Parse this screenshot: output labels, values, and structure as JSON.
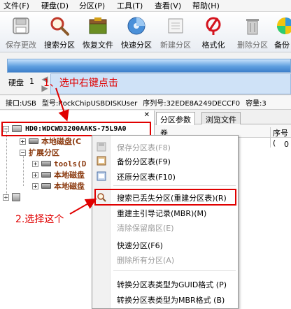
{
  "menu": [
    "文件(F)",
    "硬盘(D)",
    "分区(P)",
    "工具(T)",
    "查看(V)",
    "帮助(H)"
  ],
  "toolbar": [
    {
      "label": "保存更改",
      "icon": "save-icon",
      "enabled": false
    },
    {
      "label": "搜索分区",
      "icon": "search-partition-icon",
      "enabled": true
    },
    {
      "label": "恢复文件",
      "icon": "recover-file-icon",
      "enabled": true
    },
    {
      "label": "快速分区",
      "icon": "quick-partition-icon",
      "enabled": true
    },
    {
      "label": "新建分区",
      "icon": "new-partition-icon",
      "enabled": false
    },
    {
      "label": "格式化",
      "icon": "format-icon",
      "enabled": true
    },
    {
      "label": "删除分区",
      "icon": "delete-partition-icon",
      "enabled": false
    },
    {
      "label": "备份",
      "icon": "backup-icon",
      "enabled": true
    }
  ],
  "disk": {
    "label": "硬盘",
    "number": "1"
  },
  "info": {
    "interface": "接口:USB",
    "model": "型号:RockChipUSBDISKUser",
    "serial": "序列号:32EDE8A249DECCF0",
    "capacity": "容量:3"
  },
  "tree": {
    "disk_node": "HD0:WDCWD3200AAKS-75L9A0",
    "items": [
      {
        "label": "本地磁盘(C",
        "level": 1,
        "expander": "+"
      },
      {
        "label": "扩展分区",
        "level": 1,
        "expander": "−"
      },
      {
        "label": "tools(D",
        "level": 2,
        "expander": "+"
      },
      {
        "label": "本地磁盘",
        "level": 2,
        "expander": "+"
      },
      {
        "label": "本地磁盘",
        "level": 2,
        "expander": "+"
      }
    ]
  },
  "tabs": [
    "分区参数",
    "浏览文件"
  ],
  "table": {
    "col1": "卷",
    "col2": "序号(",
    "row0_value": "0"
  },
  "context_menu": [
    {
      "label": "保存分区表(F8)",
      "enabled": false,
      "icon": "save-table-icon"
    },
    {
      "label": "备份分区表(F9)",
      "enabled": true,
      "icon": "backup-table-icon"
    },
    {
      "label": "还原分区表(F10)",
      "enabled": true,
      "icon": "restore-table-icon"
    },
    {
      "label": "搜索已丢失分区(重建分区表)(R)",
      "enabled": true,
      "icon": "search-lost-partition-icon"
    },
    {
      "label": "重建主引导记录(MBR)(M)",
      "enabled": true
    },
    {
      "label": "清除保留扇区(E)",
      "enabled": false
    },
    {
      "label": "快速分区(F6)",
      "enabled": true
    },
    {
      "label": "删除所有分区(A)",
      "enabled": false
    },
    {
      "label": "转换分区表类型为GUID格式 (P)",
      "enabled": true
    },
    {
      "label": "转换分区表类型为MBR格式 (B)",
      "enabled": true
    }
  ],
  "annotations": {
    "step1": "1、选中右键点击",
    "step2": "2.选择这个"
  },
  "colors": {
    "annotation": "#e00000",
    "brown_text": "#8b3a0f",
    "partition_bar": "#5f9fe0"
  }
}
